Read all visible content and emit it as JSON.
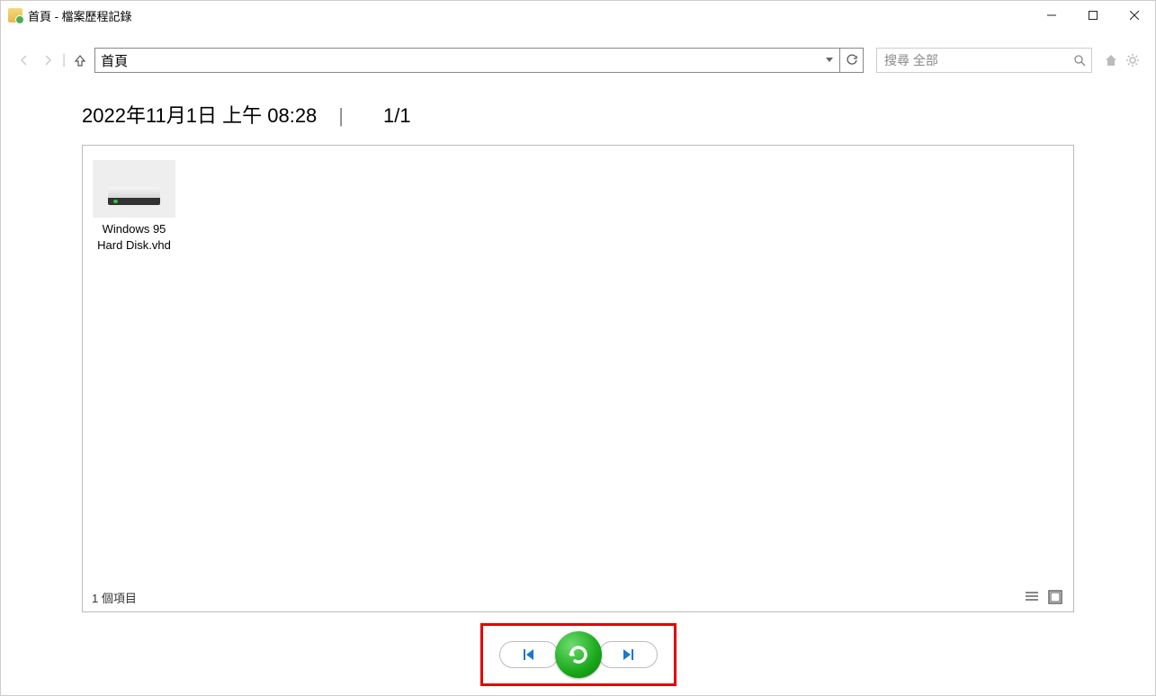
{
  "window": {
    "title": "首頁 - 檔案歷程記錄"
  },
  "toolbar": {
    "address_value": "首頁",
    "search_placeholder": "搜尋 全部"
  },
  "header": {
    "timestamp": "2022年11月1日 上午 08:28",
    "page_indicator": "1/1"
  },
  "files": [
    {
      "name": "Windows 95 Hard Disk.vhd"
    }
  ],
  "status": {
    "item_count_label": "1 個項目"
  }
}
